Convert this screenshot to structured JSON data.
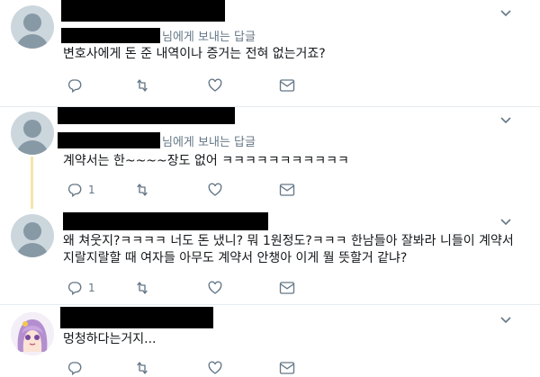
{
  "tweets": [
    {
      "reply_suffix": "님에게 보내는 답글",
      "text": "변호사에게 돈 준 내역이나 증거는 전혀 없는거죠?",
      "reply_count": ""
    },
    {
      "reply_suffix": "님에게 보내는 답글",
      "text": "계약서는 한~~~~장도 없어 ㅋㅋㅋㅋㅋㅋㅋㅋㅋㅋㅋ",
      "reply_count": "1"
    },
    {
      "text": "왜 쳐웃지?ㅋㅋㅋㅋ 너도 돈 냈니? 뭐 1원정도?ㅋㅋㅋ 한남들아 잘봐라 니들이 계약서 지랄지랄할 때 여자들 아무도 계약서 안챙아 이게 뭘 뜻할거 같냐?",
      "reply_count": "1"
    },
    {
      "text": "멍청하다는거지...",
      "reply_count": ""
    }
  ],
  "icons": [
    "reply-icon",
    "retweet-icon",
    "like-icon",
    "dm-icon",
    "caret-down-icon"
  ],
  "colors": {
    "icon": "#657786",
    "thread_line": "#f5e6a8",
    "divider": "#e6ecf0"
  }
}
